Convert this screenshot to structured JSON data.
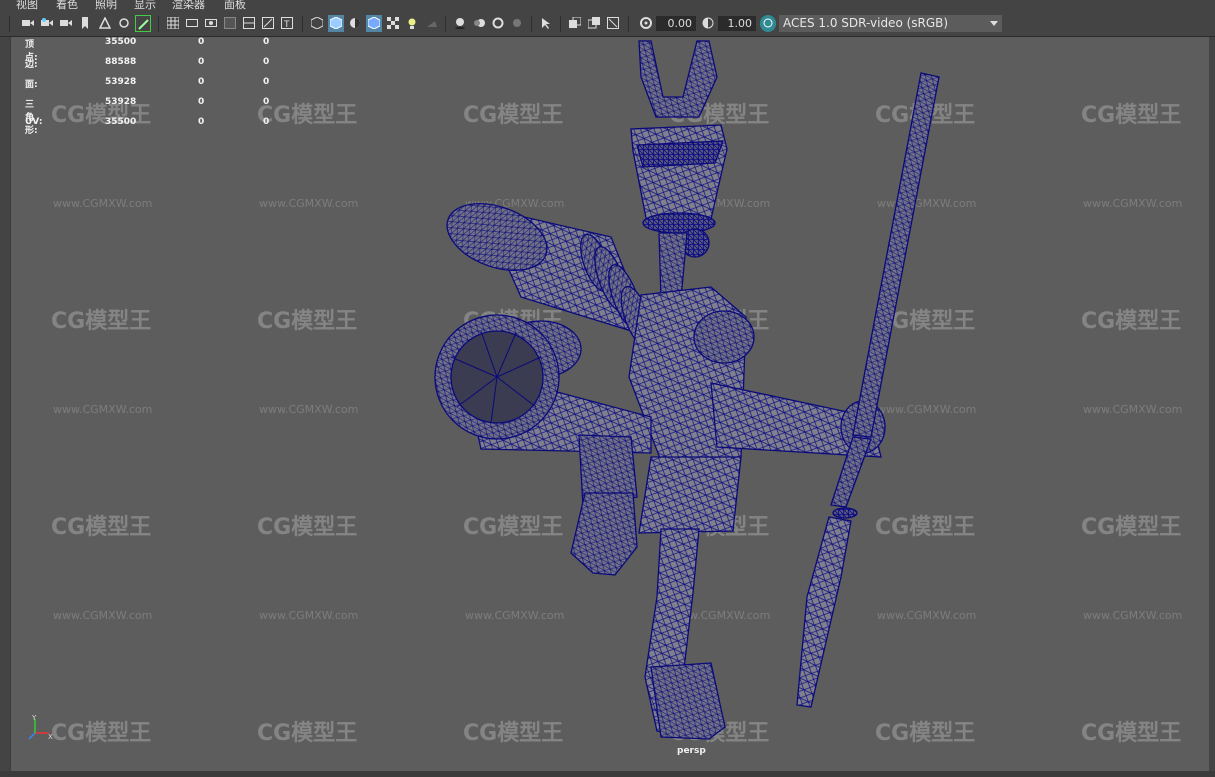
{
  "menu": [
    "视图",
    "着色",
    "照明",
    "显示",
    "渲染器",
    "面板"
  ],
  "toolbar": {
    "exposure_value": "0.00",
    "gamma_value": "1.00",
    "color_space": "ACES 1.0 SDR-video (sRGB)"
  },
  "hud": {
    "rows": [
      {
        "label": "顶点:",
        "v1": "35500",
        "v2": "0",
        "v3": "0"
      },
      {
        "label": "边:",
        "v1": "88588",
        "v2": "0",
        "v3": "0"
      },
      {
        "label": "面:",
        "v1": "53928",
        "v2": "0",
        "v3": "0"
      },
      {
        "label": "三角形:",
        "v1": "53928",
        "v2": "0",
        "v3": "0"
      },
      {
        "label": "UV:",
        "v1": "35500",
        "v2": "0",
        "v3": "0"
      }
    ]
  },
  "camera_label": "persp",
  "axis": {
    "x": "X",
    "y": "Y",
    "z": "Z"
  },
  "watermark": {
    "logo": "CG模型王",
    "url": "www.CGMXW.com"
  },
  "colors": {
    "wire": "#0a0a7a",
    "fill": "#7f7f8d",
    "viewport": "#5d5d5d",
    "toolbar": "#444444",
    "active": "#5285a6"
  }
}
